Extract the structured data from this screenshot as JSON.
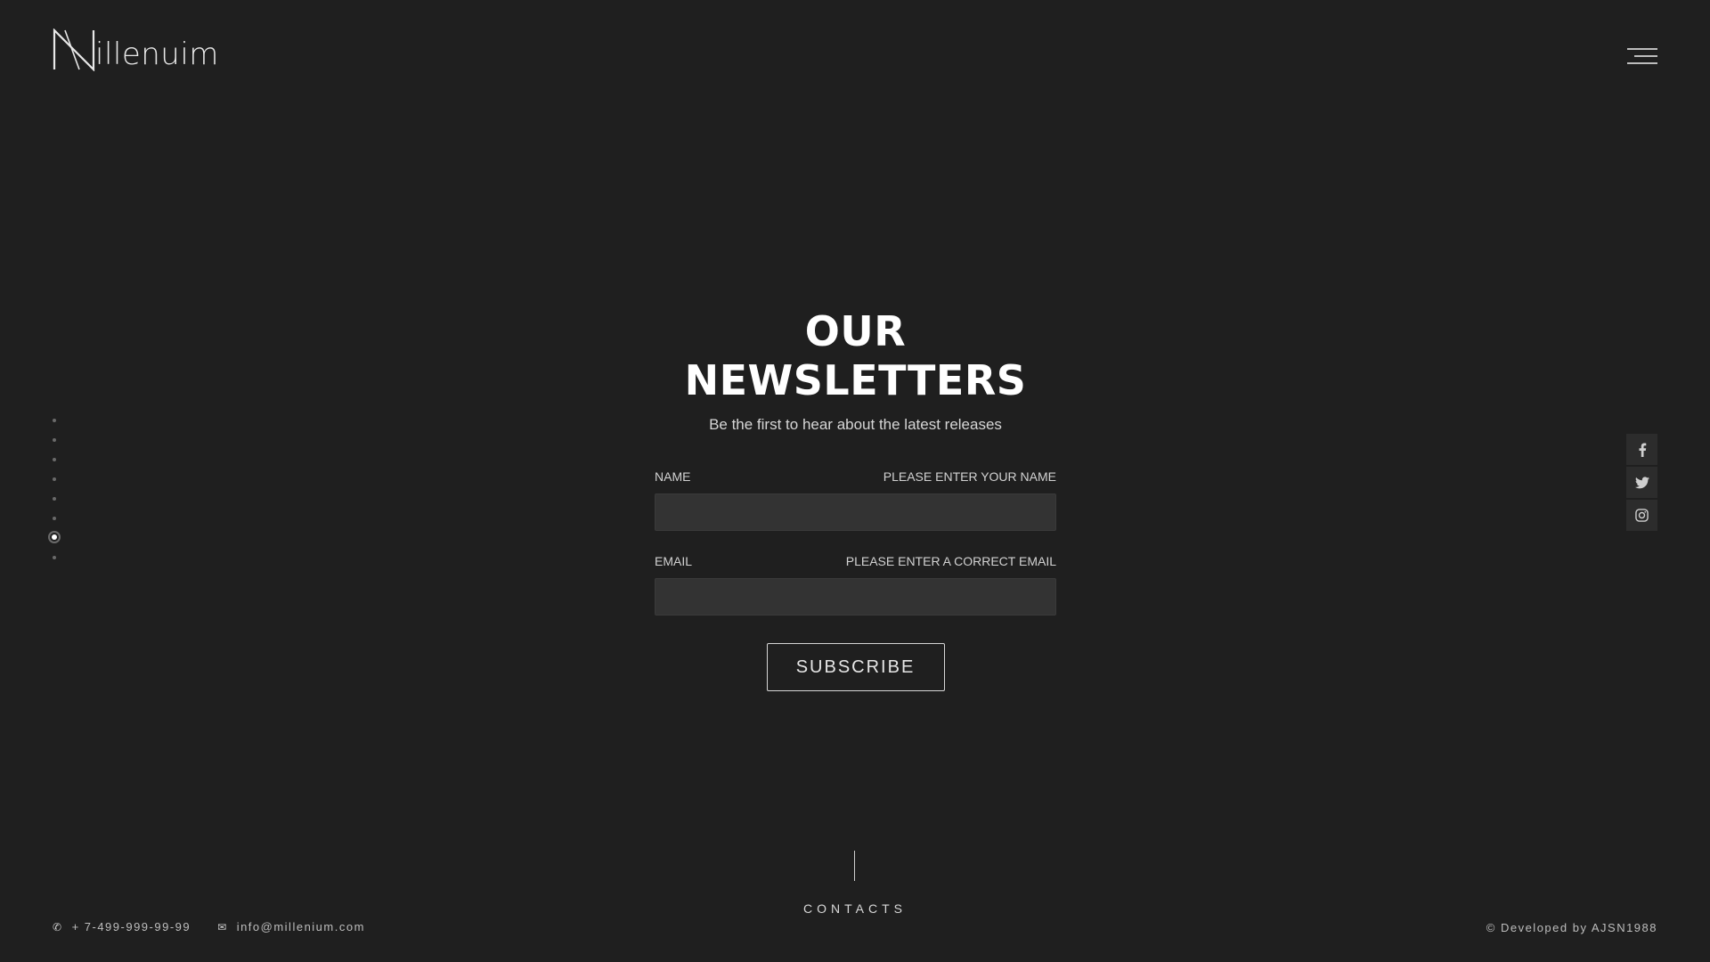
{
  "logo": {
    "text": "illenuim"
  },
  "newsletter": {
    "title": "OUR NEWSLETTERS",
    "subtitle": "Be the first to hear about the latest releases",
    "name_label": "NAME",
    "name_hint": "PLEASE ENTER YOUR NAME",
    "name_value": "",
    "email_label": "EMAIL",
    "email_hint": "PLEASE ENTER A CORRECT EMAIL",
    "email_value": "",
    "subscribe_label": "SUBSCRIBE"
  },
  "side_nav": {
    "count": 8,
    "active_index": 6
  },
  "social": {
    "items": [
      "facebook-icon",
      "twitter-icon",
      "instagram-icon"
    ]
  },
  "footer": {
    "contacts_label": "CONTACTS",
    "phone": "+ 7-499-999-99-99",
    "email": "info@millenium.com",
    "credits": "© Developed by AJSN1988"
  },
  "colors": {
    "background": "#1f1f1f",
    "input_bg": "#333333",
    "text": "#ffffff"
  }
}
